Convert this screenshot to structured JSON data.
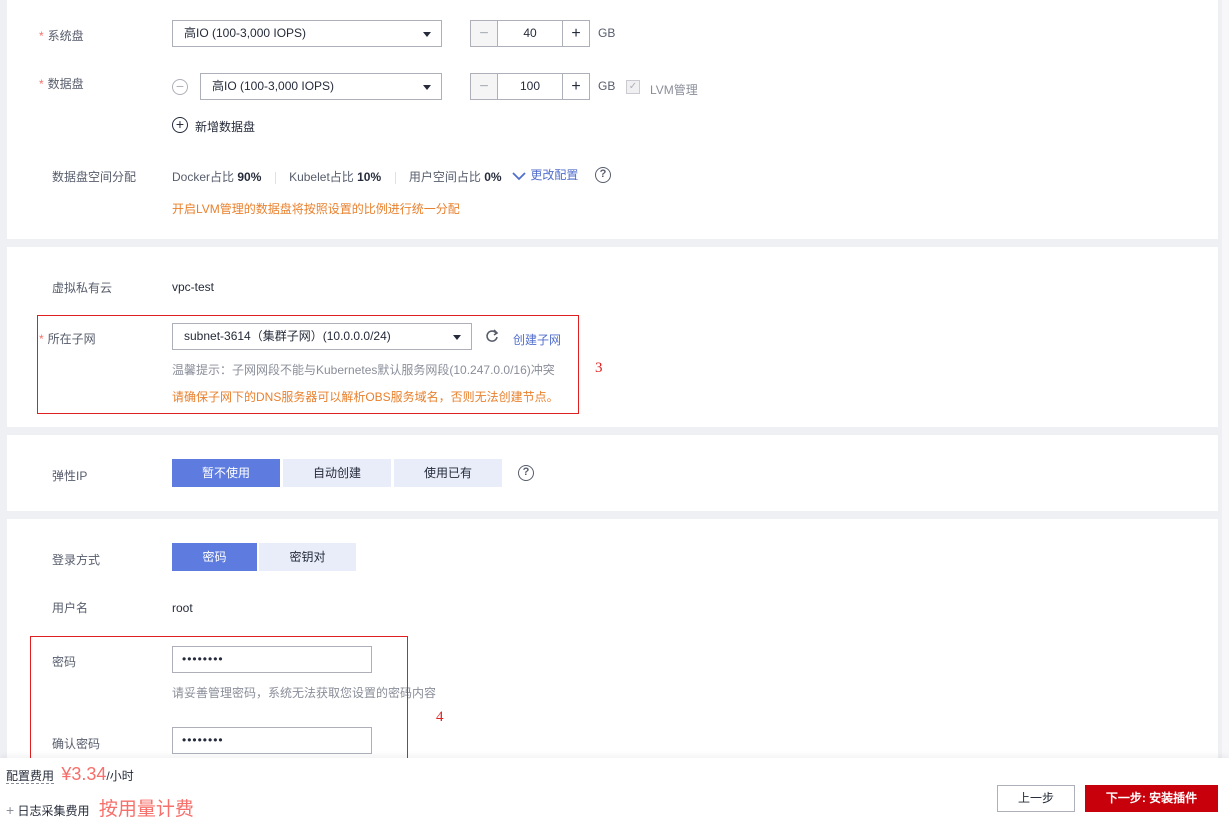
{
  "disk": {
    "system_label": "系统盘",
    "system_type": "高IO (100-3,000 IOPS)",
    "system_size": "40",
    "data_label": "数据盘",
    "data_type": "高IO (100-3,000 IOPS)",
    "data_size": "100",
    "unit": "GB",
    "lvm_label": "LVM管理",
    "add_data_disk": "新增数据盘",
    "space_label": "数据盘空间分配",
    "docker_label": "Docker占比",
    "docker_value": "90%",
    "kubelet_label": "Kubelet占比",
    "kubelet_value": "10%",
    "user_label": "用户空间占比",
    "user_value": "0%",
    "change_config": "更改配置",
    "lvm_hint": "开启LVM管理的数据盘将按照设置的比例进行统一分配"
  },
  "network": {
    "vpc_label": "虚拟私有云",
    "vpc_value": "vpc-test",
    "subnet_label": "所在子网",
    "subnet_value": "subnet-3614（集群子网）(10.0.0.0/24)",
    "create_subnet": "创建子网",
    "tip": "温馨提示：子网网段不能与Kubernetes默认服务网段(10.247.0.0/16)冲突",
    "dns_warning": "请确保子网下的DNS服务器可以解析OBS服务域名，否则无法创建节点。",
    "annotation": "3"
  },
  "eip": {
    "label": "弹性IP",
    "options": [
      "暂不使用",
      "自动创建",
      "使用已有"
    ]
  },
  "login": {
    "label": "登录方式",
    "options": [
      "密码",
      "密钥对"
    ],
    "username_label": "用户名",
    "username_value": "root",
    "password_label": "密码",
    "password_value": "••••••••",
    "password_hint": "请妥善管理密码，系统无法获取您设置的密码内容",
    "confirm_label": "确认密码",
    "confirm_value": "••••••••",
    "annotation": "4"
  },
  "footer": {
    "config_fee_label": "配置费用",
    "price": "¥3.34",
    "per_hour": "/小时",
    "log_fee_label": "日志采集费用",
    "log_fee_value": "按用量计费",
    "prev": "上一步",
    "next": "下一步: 安装插件"
  }
}
